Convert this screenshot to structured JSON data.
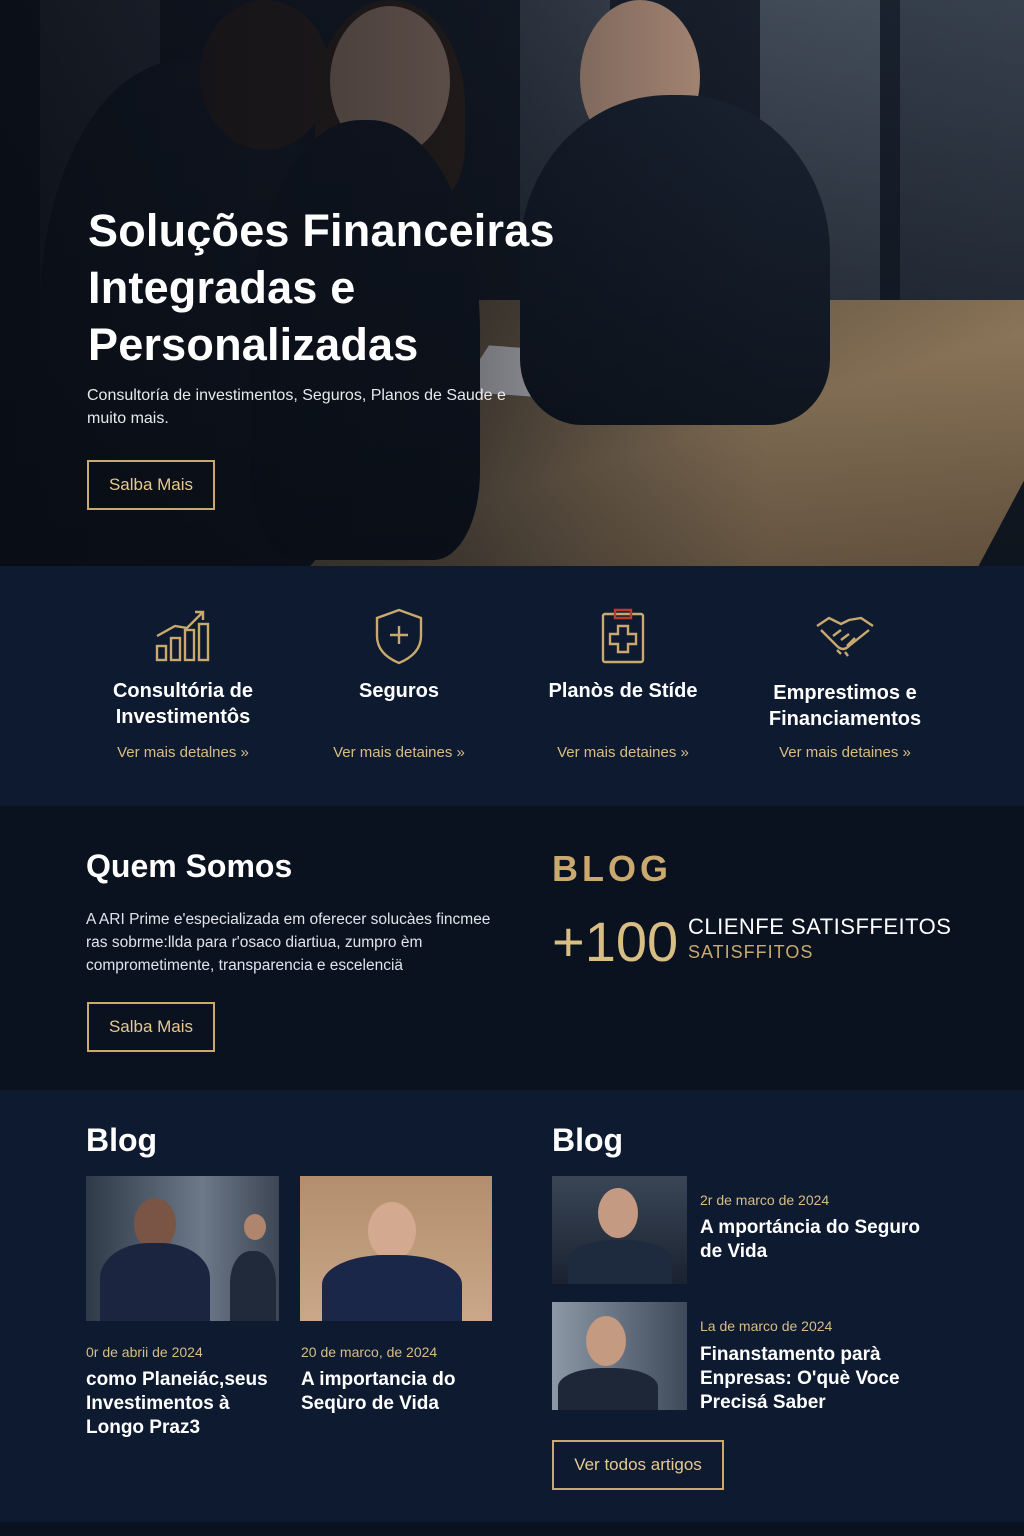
{
  "hero": {
    "title": "Soluções Financeiras Integradas e Personalizadas",
    "subtitle": "Consultoría de investimentos, Seguros, Planos de Saude e muito mais.",
    "button_label": "Salba Mais"
  },
  "services": [
    {
      "icon": "bar-chart-icon",
      "name": "Consultória de Investimentôs",
      "link": "Ver mais detalnes »"
    },
    {
      "icon": "shield-icon",
      "name": "Seguros",
      "link": "Ver mais detaines »"
    },
    {
      "icon": "medical-clipboard-icon",
      "name": "Planòs de Stíde",
      "link": "Ver mais detaines »"
    },
    {
      "icon": "handshake-icon",
      "name": "Emprestimos e Financiamentos",
      "link": "Ver mais detaines »"
    }
  ],
  "about": {
    "title": "Quem Somos",
    "text": "A ARI Prime e'especializada em oferecer solucàes fincmee ras sobrme:llda para r'osaco diartiua, zumpro èm comprometimente, transparencia e escelenciä",
    "button_label": "Salba Mais"
  },
  "stats": {
    "kicker": "BLOG",
    "number": "+100",
    "line1": "CLIENFE SATISFFEITOS",
    "line2": "SATISFFITOS"
  },
  "blog": {
    "title_left": "Blog",
    "title_right": "Blog",
    "cards": [
      {
        "date": "0r de abrii de 2024",
        "title": "como Planeiác,seus Investimentos à Longo Praz3"
      },
      {
        "date": "20 de marco, de 2024",
        "title": "A importancia do Seqùro de Vida"
      }
    ],
    "list": [
      {
        "date": "2r de marco de 2024",
        "title": "A mportáncia do Seguro de Vida"
      },
      {
        "date": "La de marco de 2024",
        "title": "Finanstamento parà Enpresas: O'què Voce Precisá Saber"
      }
    ],
    "all_button": "Ver todos artigos"
  },
  "colors": {
    "gold": "#c9a96e",
    "navy": "#0d1a30",
    "dark": "#0a1220"
  }
}
